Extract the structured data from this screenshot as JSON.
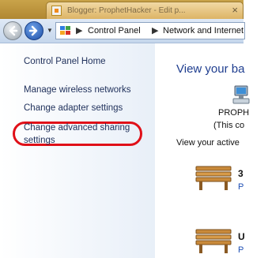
{
  "browser_tab": {
    "title": "Blogger: ProphetHacker - Edit p..."
  },
  "address_bar": {
    "crumbs": [
      "Control Panel",
      "Network and Internet"
    ],
    "separator": "▶"
  },
  "sidebar": {
    "home_link": "Control Panel Home",
    "links": [
      "Manage wireless networks",
      "Change adapter settings",
      "Change advanced sharing settings"
    ],
    "highlight_color": "#e01018"
  },
  "main": {
    "heading": "View your ba",
    "computer_name": "PROPH",
    "computer_subtitle": "(This co",
    "active_heading": "View your active",
    "networks": [
      {
        "name": "3",
        "link": "P"
      },
      {
        "name": "U",
        "link": "P"
      }
    ]
  },
  "colors": {
    "link": "#1e2f5a",
    "heading": "#1e3d8f",
    "accent_blue": "#1e4fb5"
  }
}
